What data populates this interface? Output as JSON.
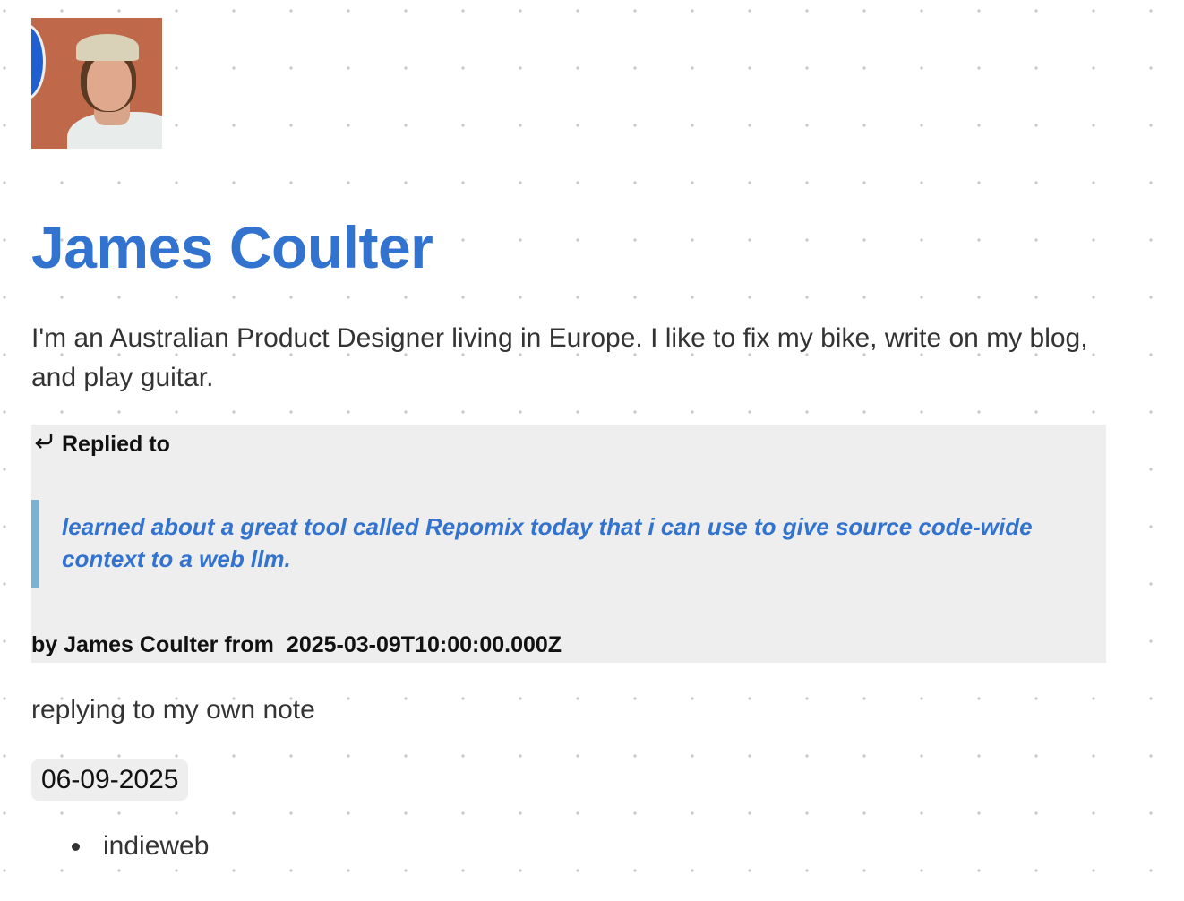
{
  "profile": {
    "name": "James Coulter",
    "bio": "I'm an Australian Product Designer living in Europe. I like to fix my bike, write on my blog, and play guitar."
  },
  "reply": {
    "icon": "reply-arrow-icon",
    "heading": "Replied to",
    "quote": "learned about a great tool called Repomix today that i can use to give source code-wide context to a web llm.",
    "by_label": "by James Coulter from",
    "date": "2025-03-09T10:00:00.000Z",
    "border_color": "#7ab3d1",
    "link_color": "#3273cf"
  },
  "note": {
    "content": "replying to my own note",
    "date": "06-09-2025",
    "tags": [
      "indieweb"
    ]
  }
}
